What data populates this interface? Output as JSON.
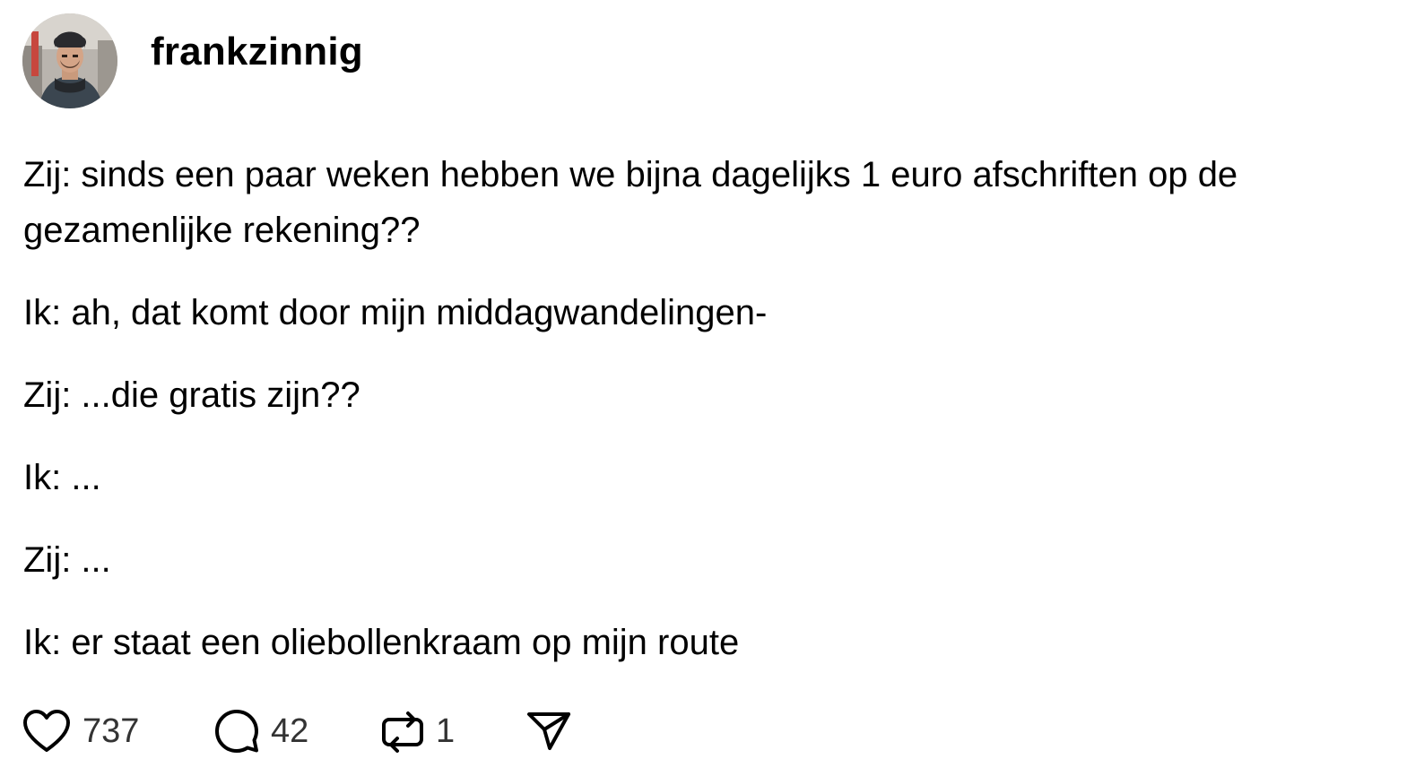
{
  "author": {
    "username": "frankzinnig",
    "avatar_icon": "avatar-photo"
  },
  "post": {
    "paragraphs": [
      [
        "Zij: sinds een paar weken hebben we bijna dagelijks 1 euro afschriften op de",
        "gezamenlijke rekening??"
      ],
      [
        "Ik: ah, dat komt door mijn middagwandelingen-"
      ],
      [
        "Zij: ...die gratis zijn??"
      ],
      [
        "Ik: ..."
      ],
      [
        "Zij: ..."
      ],
      [
        "Ik: er staat een oliebollenkraam op mijn route"
      ]
    ]
  },
  "actions": {
    "like": {
      "icon": "heart-icon",
      "count": "737"
    },
    "reply": {
      "icon": "comment-icon",
      "count": "42"
    },
    "repost": {
      "icon": "repost-icon",
      "count": "1"
    },
    "share": {
      "icon": "send-icon"
    }
  },
  "colors": {
    "text": "#000000",
    "count_text": "#333333",
    "icon_stroke": "#000000"
  }
}
